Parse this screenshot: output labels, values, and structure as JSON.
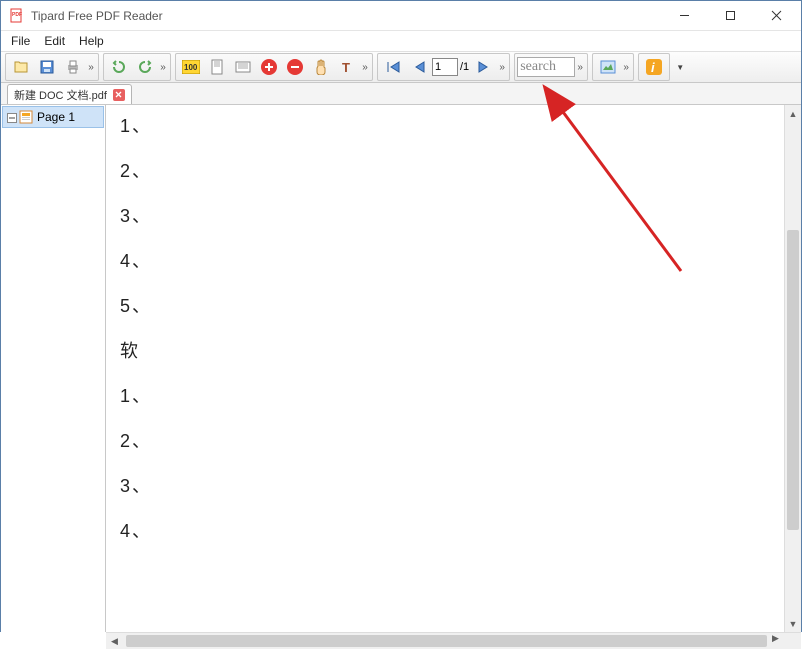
{
  "title": "Tipard Free PDF Reader",
  "menu": {
    "file": "File",
    "edit": "Edit",
    "help": "Help"
  },
  "tab": {
    "label": "新建 DOC 文档.pdf"
  },
  "sidebar": {
    "page1": "Page 1"
  },
  "nav": {
    "current_page": "1",
    "total_pages": "/1"
  },
  "search": {
    "placeholder": "search"
  },
  "doc_lines": [
    "1、",
    "2、",
    "3、",
    "4、",
    "5、",
    "软",
    "1、",
    "2、",
    "3、",
    "4、"
  ],
  "colors": {
    "accent": "#cfe3f8",
    "arrow": "#d62424"
  }
}
